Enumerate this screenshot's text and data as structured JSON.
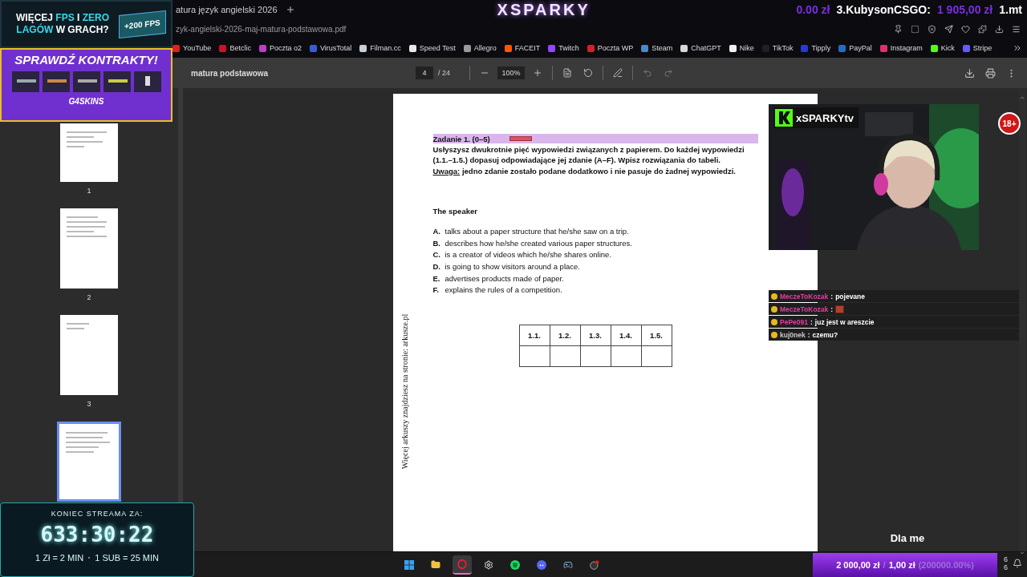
{
  "browser": {
    "tab_title": "atura język angielski 2026",
    "logo": "XSPARKY",
    "ticker": [
      {
        "kind": "amount",
        "text": "0.00 zł"
      },
      {
        "kind": "name",
        "text": "3.KubysonCSGO:"
      },
      {
        "kind": "amount",
        "text": "1 905,00 zł"
      },
      {
        "kind": "name",
        "text": "1.mt"
      }
    ],
    "address": "zyk-angielski-2026-maj-matura-podstawowa.pdf",
    "bookmarks": [
      {
        "label": "YouTube",
        "color": "#e02020"
      },
      {
        "label": "Betclic",
        "color": "#d0102a"
      },
      {
        "label": "Poczta o2",
        "color": "#c03cc8"
      },
      {
        "label": "VirusTotal",
        "color": "#3a5bd8"
      },
      {
        "label": "Filman.cc",
        "color": "#c8d0d8"
      },
      {
        "label": "Speed Test",
        "color": "#e8e8e8"
      },
      {
        "label": "Allegro",
        "color": "#9a9a9a"
      },
      {
        "label": "FACEIT",
        "color": "#ff5500"
      },
      {
        "label": "Twitch",
        "color": "#9146ff"
      },
      {
        "label": "Poczta WP",
        "color": "#d81e2a"
      },
      {
        "label": "Steam",
        "color": "#4a8ac8"
      },
      {
        "label": "ChatGPT",
        "color": "#d8d8d8"
      },
      {
        "label": "Nike",
        "color": "#f0f0f0"
      },
      {
        "label": "TikTok",
        "color": "#202020"
      },
      {
        "label": "Tipply",
        "color": "#2a38d8"
      },
      {
        "label": "PayPal",
        "color": "#1a70c8"
      },
      {
        "label": "Instagram",
        "color": "#e0306a"
      },
      {
        "label": "Kick",
        "color": "#53fc18"
      },
      {
        "label": "Stripe",
        "color": "#635bff"
      }
    ]
  },
  "pdf_toolbar": {
    "title": "matura podstawowa",
    "page": "4",
    "page_count": "/ 24",
    "zoom": "100%"
  },
  "thumbnails": [
    {
      "label": "1",
      "selected": false
    },
    {
      "label": "2",
      "selected": false
    },
    {
      "label": "3",
      "selected": false
    },
    {
      "selected": true
    }
  ],
  "document": {
    "task_title": "Zadanie 1. (0–5)",
    "instruction": "Usłyszysz dwukrotnie pięć wypowiedzi związanych z papierem. Do każdej wypowiedzi (1.1.–1.5.) dopasuj odpowiadające jej zdanie (A–F). Wpisz rozwiązania do tabeli.",
    "note_label": "Uwaga:",
    "note": "jedno zdanie zostało podane dodatkowo i nie pasuje do żadnej wypowiedzi.",
    "lead": "The speaker",
    "options": [
      {
        "letter": "A.",
        "text": "talks about a paper structure that he/she saw on a trip."
      },
      {
        "letter": "B.",
        "text": "describes how he/she created various paper structures."
      },
      {
        "letter": "C.",
        "text": "is a creator of videos which he/she shares online."
      },
      {
        "letter": "D.",
        "text": "is going to show visitors around a place."
      },
      {
        "letter": "E.",
        "text": "advertises products made of paper."
      },
      {
        "letter": "F.",
        "text": "explains the rules of a competition."
      }
    ],
    "answer_table": {
      "columns": [
        "1.1.",
        "1.2.",
        "1.3.",
        "1.4.",
        "1.5."
      ]
    },
    "side_note": "Więcej arkuszy znajdziesz na stronie: arkusze.pl"
  },
  "ad": {
    "headline": [
      {
        "text": "WIĘCEJ ",
        "highlight": false
      },
      {
        "text": "FPS",
        "highlight": true
      },
      {
        "text": " I ",
        "highlight": false
      },
      {
        "text": "ZERO",
        "highlight": true
      },
      {
        "text": " LAGÓW",
        "highlight": true
      },
      {
        "text": " W GRACH?",
        "highlight": false
      }
    ],
    "badge": "+200 FPS",
    "cta": "SPRAWDŹ KONTRAKTY!",
    "brand": "G4SKINS"
  },
  "webcam": {
    "channel": "xSPARKYtv",
    "age_badge": "18+"
  },
  "chat": [
    {
      "user": "MeczeToKozak",
      "color": "#e040a0",
      "separator": ":",
      "text": "pojevane",
      "kind": "text"
    },
    {
      "user": "MeczeToKozak",
      "color": "#e040a0",
      "separator": ":",
      "kind": "emote"
    },
    {
      "user": "PePe091",
      "color": "#e040a0",
      "separator": ":",
      "text": "juz jest w areszcie",
      "kind": "text"
    },
    {
      "user": "kuj0nek",
      "color": "#c8c8c8",
      "separator": ":",
      "text": "czemu?",
      "kind": "text"
    }
  ],
  "timer": {
    "title": "KONIEC STREAMA ZA:",
    "time": "633:30:22",
    "rates": [
      "1 Zł = 2 MIN",
      "1 SUB = 25 MIN"
    ]
  },
  "alert": {
    "text": "Dla me"
  },
  "goal": {
    "current": "2 000,00 zł",
    "separator": "/",
    "target": "1,00 zł",
    "percent": "(200000.00%)",
    "level": 1
  },
  "taskbar": {
    "apps": [
      {
        "kind": "windows",
        "selected": false
      },
      {
        "kind": "folder",
        "selected": false
      },
      {
        "kind": "opera",
        "selected": true
      },
      {
        "kind": "steelseries",
        "selected": false
      },
      {
        "kind": "spotify",
        "selected": false
      },
      {
        "kind": "discord",
        "selected": false
      },
      {
        "kind": "steam",
        "selected": false
      },
      {
        "kind": "obs",
        "selected": false
      }
    ],
    "tray_numbers": [
      "6",
      "6"
    ]
  }
}
